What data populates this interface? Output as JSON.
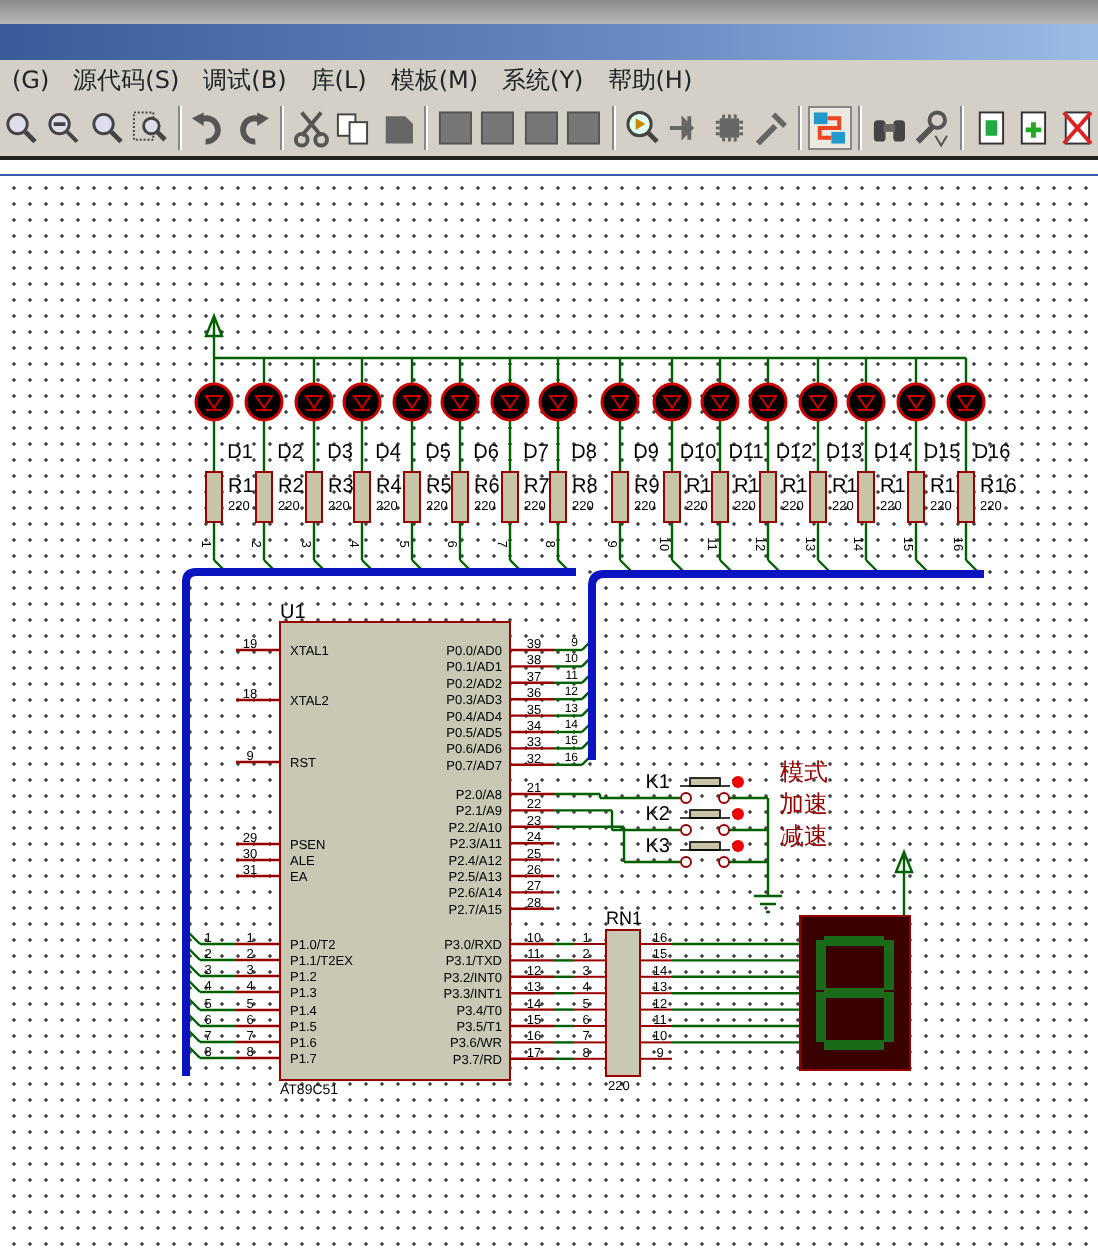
{
  "menu": [
    "(G)",
    "源代码(S)",
    "调试(B)",
    "库(L)",
    "模板(M)",
    "系统(Y)",
    "帮助(H)"
  ],
  "schematic": {
    "leds": [
      {
        "diode": "D1",
        "resistor": "R1",
        "value": "220",
        "net": "1"
      },
      {
        "diode": "D2",
        "resistor": "R2",
        "value": "220",
        "net": "2"
      },
      {
        "diode": "D3",
        "resistor": "R3",
        "value": "220",
        "net": "3"
      },
      {
        "diode": "D4",
        "resistor": "R4",
        "value": "220",
        "net": "4"
      },
      {
        "diode": "D5",
        "resistor": "R5",
        "value": "220",
        "net": "5"
      },
      {
        "diode": "D6",
        "resistor": "R6",
        "value": "220",
        "net": "6"
      },
      {
        "diode": "D7",
        "resistor": "R7",
        "value": "220",
        "net": "7"
      },
      {
        "diode": "D8",
        "resistor": "R8",
        "value": "220",
        "net": "8"
      },
      {
        "diode": "D9",
        "resistor": "R9",
        "value": "220",
        "net": "9"
      },
      {
        "diode": "D10",
        "resistor": "R1",
        "value": "220",
        "net": "10"
      },
      {
        "diode": "D11",
        "resistor": "R1",
        "value": "220",
        "net": "11"
      },
      {
        "diode": "D12",
        "resistor": "R1",
        "value": "220",
        "net": "12"
      },
      {
        "diode": "D13",
        "resistor": "R1",
        "value": "220",
        "net": "13"
      },
      {
        "diode": "D14",
        "resistor": "R1",
        "value": "220",
        "net": "14"
      },
      {
        "diode": "D15",
        "resistor": "R1",
        "value": "220",
        "net": "15"
      },
      {
        "diode": "D16",
        "resistor": "R16",
        "value": "220",
        "net": "16"
      }
    ],
    "chip": {
      "ref": "U1",
      "part": "AT89C51",
      "left_pins": [
        {
          "number": "19",
          "name": "XTAL1"
        },
        {
          "number": "18",
          "name": "XTAL2"
        },
        {
          "number": "9",
          "name": "RST"
        },
        {
          "number": "29",
          "name": "PSEN"
        },
        {
          "number": "30",
          "name": "ALE"
        },
        {
          "number": "31",
          "name": "EA"
        },
        {
          "number": "1",
          "name": "P1.0/T2",
          "net": "1"
        },
        {
          "number": "2",
          "name": "P1.1/T2EX",
          "net": "2"
        },
        {
          "number": "3",
          "name": "P1.2",
          "net": "3"
        },
        {
          "number": "4",
          "name": "P1.3",
          "net": "4"
        },
        {
          "number": "5",
          "name": "P1.4",
          "net": "5"
        },
        {
          "number": "6",
          "name": "P1.5",
          "net": "6"
        },
        {
          "number": "7",
          "name": "P1.6",
          "net": "7"
        },
        {
          "number": "8",
          "name": "P1.7",
          "net": "8"
        }
      ],
      "right_pins": [
        {
          "number": "39",
          "name": "P0.0/AD0",
          "net": "9"
        },
        {
          "number": "38",
          "name": "P0.1/AD1",
          "net": "10"
        },
        {
          "number": "37",
          "name": "P0.2/AD2",
          "net": "11"
        },
        {
          "number": "36",
          "name": "P0.3/AD3",
          "net": "12"
        },
        {
          "number": "35",
          "name": "P0.4/AD4",
          "net": "13"
        },
        {
          "number": "34",
          "name": "P0.5/AD5",
          "net": "14"
        },
        {
          "number": "33",
          "name": "P0.6/AD6",
          "net": "15"
        },
        {
          "number": "32",
          "name": "P0.7/AD7",
          "net": "16"
        },
        {
          "number": "21",
          "name": "P2.0/A8"
        },
        {
          "number": "22",
          "name": "P2.1/A9"
        },
        {
          "number": "23",
          "name": "P2.2/A10"
        },
        {
          "number": "24",
          "name": "P2.3/A11"
        },
        {
          "number": "25",
          "name": "P2.4/A12"
        },
        {
          "number": "26",
          "name": "P2.5/A13"
        },
        {
          "number": "27",
          "name": "P2.6/A14"
        },
        {
          "number": "28",
          "name": "P2.7/A15"
        },
        {
          "number": "10",
          "name": "P3.0/RXD"
        },
        {
          "number": "11",
          "name": "P3.1/TXD"
        },
        {
          "number": "12",
          "name": "P3.2/INT0"
        },
        {
          "number": "13",
          "name": "P3.3/INT1"
        },
        {
          "number": "14",
          "name": "P3.4/T0"
        },
        {
          "number": "15",
          "name": "P3.5/T1"
        },
        {
          "number": "16",
          "name": "P3.6/WR"
        },
        {
          "number": "17",
          "name": "P3.7/RD"
        }
      ]
    },
    "switches": [
      {
        "ref": "K1",
        "label": "模式",
        "pressed": false
      },
      {
        "ref": "K2",
        "label": "加速",
        "pressed": false
      },
      {
        "ref": "K3",
        "label": "减速",
        "pressed": false
      }
    ],
    "network": {
      "ref": "RN1",
      "value": "220",
      "left_pins": [
        "1",
        "2",
        "3",
        "4",
        "5",
        "6",
        "7",
        "8"
      ],
      "right_pins": [
        "16",
        "15",
        "14",
        "13",
        "12",
        "11",
        "10",
        "9"
      ]
    }
  }
}
